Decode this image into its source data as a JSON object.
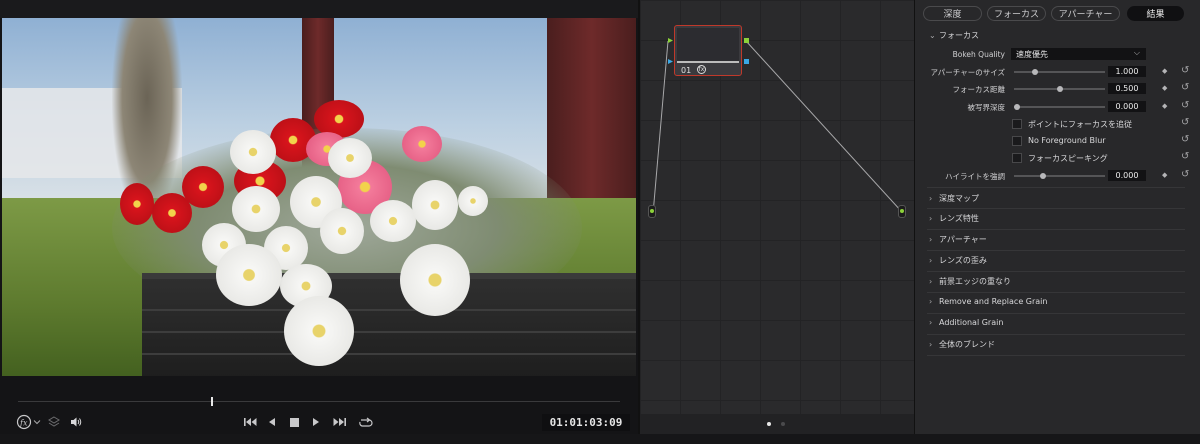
{
  "viewer": {
    "timecode": "01:01:03:09",
    "icons": [
      "fx-icon",
      "chevron-down-icon",
      "layers-icon",
      "speaker-icon",
      "skip-back-icon",
      "play-reverse-icon",
      "stop-icon",
      "play-icon",
      "skip-forward-icon",
      "loop-icon"
    ],
    "playhead_fraction": 0.32
  },
  "node_editor": {
    "node_label": "01",
    "page_dots": 2
  },
  "inspector": {
    "tabs": [
      {
        "label": "深度",
        "active": false
      },
      {
        "label": "フォーカス",
        "active": false
      },
      {
        "label": "アパーチャー",
        "active": false
      },
      {
        "label": "結果",
        "active": true
      }
    ],
    "focus_section": {
      "title": "フォーカス",
      "bokeh_label": "Bokeh Quality",
      "bokeh_value": "速度優先",
      "params": [
        {
          "label": "アパーチャーのサイズ",
          "value": "1.000",
          "fraction": 0.21
        },
        {
          "label": "フォーカス距離",
          "value": "0.500",
          "fraction": 0.5
        },
        {
          "label": "被写界深度",
          "value": "0.000",
          "fraction": 0.0
        }
      ],
      "checkboxes": [
        {
          "label": "ポイントにフォーカスを追従",
          "checked": false
        },
        {
          "label": "No Foreground Blur",
          "checked": false
        },
        {
          "label": "フォーカスピーキング",
          "checked": false
        }
      ],
      "highlight": {
        "label": "ハイライトを強調",
        "value": "0.000",
        "fraction": 0.3
      }
    },
    "collapsed_sections": [
      "深度マップ",
      "レンズ特性",
      "アパーチャー",
      "レンズの歪み",
      "前景エッジの重なり",
      "Remove and Replace Grain",
      "Additional Grain",
      "全体のブレンド"
    ]
  }
}
